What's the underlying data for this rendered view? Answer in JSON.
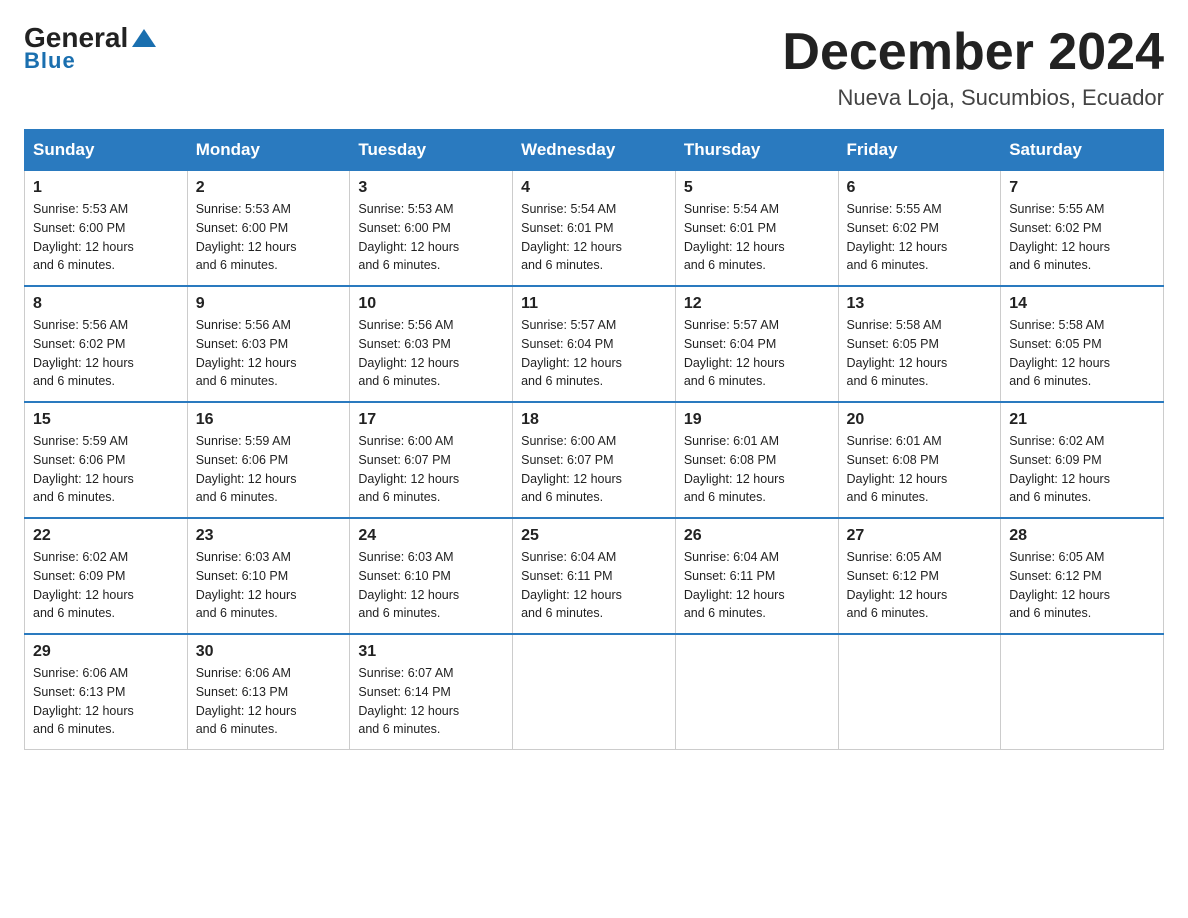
{
  "logo": {
    "text_general": "General",
    "text_blue": "Blue"
  },
  "header": {
    "month": "December 2024",
    "location": "Nueva Loja, Sucumbios, Ecuador"
  },
  "days_of_week": [
    "Sunday",
    "Monday",
    "Tuesday",
    "Wednesday",
    "Thursday",
    "Friday",
    "Saturday"
  ],
  "weeks": [
    [
      {
        "day": "1",
        "sunrise": "5:53 AM",
        "sunset": "6:00 PM",
        "daylight": "12 hours and 6 minutes."
      },
      {
        "day": "2",
        "sunrise": "5:53 AM",
        "sunset": "6:00 PM",
        "daylight": "12 hours and 6 minutes."
      },
      {
        "day": "3",
        "sunrise": "5:53 AM",
        "sunset": "6:00 PM",
        "daylight": "12 hours and 6 minutes."
      },
      {
        "day": "4",
        "sunrise": "5:54 AM",
        "sunset": "6:01 PM",
        "daylight": "12 hours and 6 minutes."
      },
      {
        "day": "5",
        "sunrise": "5:54 AM",
        "sunset": "6:01 PM",
        "daylight": "12 hours and 6 minutes."
      },
      {
        "day": "6",
        "sunrise": "5:55 AM",
        "sunset": "6:02 PM",
        "daylight": "12 hours and 6 minutes."
      },
      {
        "day": "7",
        "sunrise": "5:55 AM",
        "sunset": "6:02 PM",
        "daylight": "12 hours and 6 minutes."
      }
    ],
    [
      {
        "day": "8",
        "sunrise": "5:56 AM",
        "sunset": "6:02 PM",
        "daylight": "12 hours and 6 minutes."
      },
      {
        "day": "9",
        "sunrise": "5:56 AM",
        "sunset": "6:03 PM",
        "daylight": "12 hours and 6 minutes."
      },
      {
        "day": "10",
        "sunrise": "5:56 AM",
        "sunset": "6:03 PM",
        "daylight": "12 hours and 6 minutes."
      },
      {
        "day": "11",
        "sunrise": "5:57 AM",
        "sunset": "6:04 PM",
        "daylight": "12 hours and 6 minutes."
      },
      {
        "day": "12",
        "sunrise": "5:57 AM",
        "sunset": "6:04 PM",
        "daylight": "12 hours and 6 minutes."
      },
      {
        "day": "13",
        "sunrise": "5:58 AM",
        "sunset": "6:05 PM",
        "daylight": "12 hours and 6 minutes."
      },
      {
        "day": "14",
        "sunrise": "5:58 AM",
        "sunset": "6:05 PM",
        "daylight": "12 hours and 6 minutes."
      }
    ],
    [
      {
        "day": "15",
        "sunrise": "5:59 AM",
        "sunset": "6:06 PM",
        "daylight": "12 hours and 6 minutes."
      },
      {
        "day": "16",
        "sunrise": "5:59 AM",
        "sunset": "6:06 PM",
        "daylight": "12 hours and 6 minutes."
      },
      {
        "day": "17",
        "sunrise": "6:00 AM",
        "sunset": "6:07 PM",
        "daylight": "12 hours and 6 minutes."
      },
      {
        "day": "18",
        "sunrise": "6:00 AM",
        "sunset": "6:07 PM",
        "daylight": "12 hours and 6 minutes."
      },
      {
        "day": "19",
        "sunrise": "6:01 AM",
        "sunset": "6:08 PM",
        "daylight": "12 hours and 6 minutes."
      },
      {
        "day": "20",
        "sunrise": "6:01 AM",
        "sunset": "6:08 PM",
        "daylight": "12 hours and 6 minutes."
      },
      {
        "day": "21",
        "sunrise": "6:02 AM",
        "sunset": "6:09 PM",
        "daylight": "12 hours and 6 minutes."
      }
    ],
    [
      {
        "day": "22",
        "sunrise": "6:02 AM",
        "sunset": "6:09 PM",
        "daylight": "12 hours and 6 minutes."
      },
      {
        "day": "23",
        "sunrise": "6:03 AM",
        "sunset": "6:10 PM",
        "daylight": "12 hours and 6 minutes."
      },
      {
        "day": "24",
        "sunrise": "6:03 AM",
        "sunset": "6:10 PM",
        "daylight": "12 hours and 6 minutes."
      },
      {
        "day": "25",
        "sunrise": "6:04 AM",
        "sunset": "6:11 PM",
        "daylight": "12 hours and 6 minutes."
      },
      {
        "day": "26",
        "sunrise": "6:04 AM",
        "sunset": "6:11 PM",
        "daylight": "12 hours and 6 minutes."
      },
      {
        "day": "27",
        "sunrise": "6:05 AM",
        "sunset": "6:12 PM",
        "daylight": "12 hours and 6 minutes."
      },
      {
        "day": "28",
        "sunrise": "6:05 AM",
        "sunset": "6:12 PM",
        "daylight": "12 hours and 6 minutes."
      }
    ],
    [
      {
        "day": "29",
        "sunrise": "6:06 AM",
        "sunset": "6:13 PM",
        "daylight": "12 hours and 6 minutes."
      },
      {
        "day": "30",
        "sunrise": "6:06 AM",
        "sunset": "6:13 PM",
        "daylight": "12 hours and 6 minutes."
      },
      {
        "day": "31",
        "sunrise": "6:07 AM",
        "sunset": "6:14 PM",
        "daylight": "12 hours and 6 minutes."
      },
      null,
      null,
      null,
      null
    ]
  ]
}
